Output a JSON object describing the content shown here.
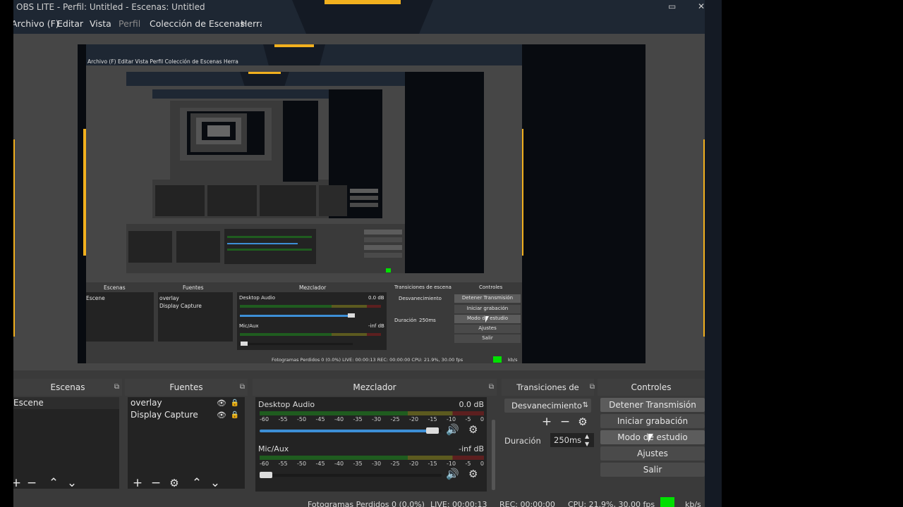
{
  "window": {
    "title": "OBS LITE - Perfil: Untitled - Escenas: Untitled",
    "minimize_glyph": "▭",
    "close_glyph": "✕"
  },
  "menu": [
    {
      "label": "Archivo (F)",
      "disabled": false
    },
    {
      "label": "Editar",
      "disabled": false
    },
    {
      "label": "Vista",
      "disabled": false
    },
    {
      "label": "Perfil",
      "disabled": true
    },
    {
      "label": "Colección de Escenas",
      "disabled": false
    },
    {
      "label": "Herramientas",
      "disabled": false
    }
  ],
  "colors": {
    "accent_gold": "#f2b01e",
    "frame_dark": "#141a24",
    "status_green": "#00e000"
  },
  "nested_preview": {
    "menu": "Archivo (F)   Editar   Vista   Perfil   Colección de Escenas   Herra",
    "escenas_title": "Escenas",
    "escenas_item": "Escene",
    "fuentes_title": "Fuentes",
    "fuentes_items": [
      "overlay",
      "Display Capture"
    ],
    "mezclador_title": "Mezclador",
    "desktop": "Desktop Audio",
    "desktop_db": "0.0 dB",
    "mic": "Mic/Aux",
    "mic_db": "-inf dB",
    "transiciones_title": "Transiciones de escena",
    "transition": "Desvanecimiento",
    "duracion": "Duración",
    "duracion_value": "250ms",
    "controles_title": "Controles",
    "controls": [
      "Detener Transmisión",
      "Iniciar grabación",
      "Modo de estudio",
      "Ajustes",
      "Salir"
    ],
    "status": "Fotogramas Perdidos 0 (0.0%)     LIVE: 00:00:13     REC: 00:00:00     CPU: 21.9%, 30.00 fps",
    "kbs": "kb/s"
  },
  "docks": {
    "escenas": {
      "title": "Escenas",
      "items": [
        "Escene"
      ]
    },
    "fuentes": {
      "title": "Fuentes",
      "items": [
        "overlay",
        "Display Capture"
      ]
    },
    "mezclador": {
      "title": "Mezclador",
      "channels": [
        {
          "name": "Desktop Audio",
          "db": "0.0 dB",
          "volume_fraction": 0.95,
          "slider_color": "#3d8fd6"
        },
        {
          "name": "Mic/Aux",
          "db": "-inf dB",
          "volume_fraction": 0.02,
          "slider_color": "#1a1a1a"
        }
      ],
      "ticks": [
        "-60",
        "-55",
        "-50",
        "-45",
        "-40",
        "-35",
        "-30",
        "-25",
        "-20",
        "-15",
        "-10",
        "-5",
        "0"
      ]
    },
    "transiciones": {
      "title": "Transiciones de escena",
      "selected": "Desvanecimiento",
      "duration_label": "Duración",
      "duration_value": "250ms"
    },
    "controles": {
      "title": "Controles",
      "buttons": [
        "Detener Transmisión",
        "Iniciar grabación",
        "Modo de estudio",
        "Ajustes",
        "Salir"
      ]
    }
  },
  "statusbar": {
    "dropped": "Fotogramas Perdidos 0 (0.0%)",
    "live": "LIVE: 00:00:13",
    "rec": "REC: 00:00:00",
    "cpu": "CPU: 21.9%, 30.00 fps",
    "kbs": "kb/s"
  },
  "icons": {
    "add": "+",
    "remove": "−",
    "settings": "⚙",
    "up": "⌃",
    "down": "⌄",
    "eye": "👁",
    "lock": "🔒",
    "speaker": "🔊",
    "float": "⧉",
    "spin_up": "▲",
    "spin_down": "▼",
    "combo_arrows": "⇅"
  }
}
